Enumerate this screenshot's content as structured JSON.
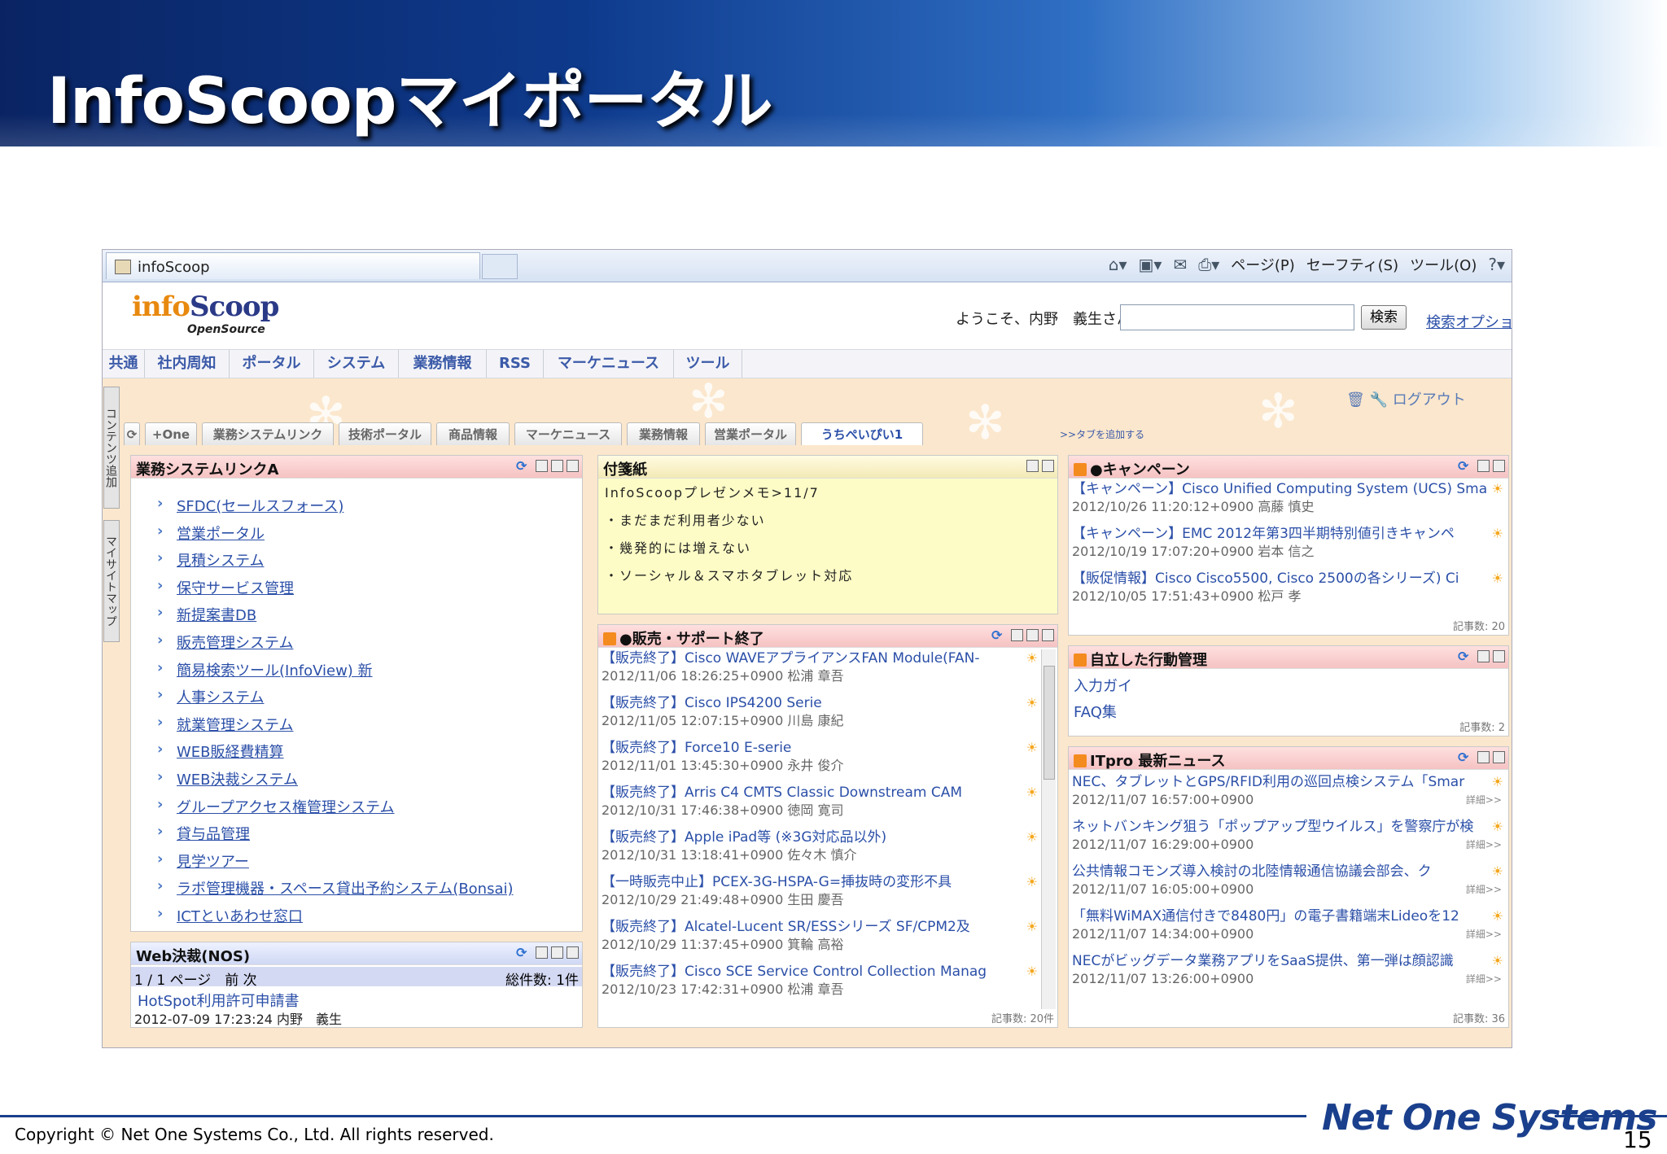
{
  "slide": {
    "title": "InfoScoopマイポータル",
    "copyright": "Copyright © Net One Systems Co., Ltd. All rights reserved.",
    "brand": "Net One Systems",
    "page_number": "15"
  },
  "browser": {
    "tab_title": "infoScoop",
    "toolbar": [
      "ページ(P)",
      "セーフティ(S)",
      "ツール(O)"
    ]
  },
  "portal": {
    "logo": "infoScoop",
    "logo_sub": "OpenSource",
    "welcome": "ようこそ、内野　義生さん",
    "search_button": "検索",
    "search_options": "検索オプショ",
    "menu": [
      "共通",
      "社内周知",
      "ポータル",
      "システム",
      "業務情報",
      "RSS",
      "マーケニュース",
      "ツール"
    ],
    "side_tabs": [
      "コンテンツ追加",
      "マイサイトマップ"
    ],
    "logout": "ログアウト",
    "tabs": [
      "+One",
      "業務システムリンク",
      "技術ポータル",
      "商品情報",
      "マーケニュース",
      "業務情報",
      "営業ポータル",
      "うちぺいぴい1"
    ],
    "add_tab": ">>タブを追加する"
  },
  "widgets": {
    "links": {
      "title": "業務システムリンクA",
      "items": [
        "SFDC(セールスフォース)",
        "営業ポータル",
        "見積システム",
        "保守サービス管理",
        "新提案書DB",
        "販売管理システム",
        "簡易検索ツール(InfoView) 新",
        "人事システム",
        "就業管理システム",
        "WEB販経費精算",
        "WEB決裁システム",
        "グループアクセス権管理システム",
        "貸与品管理",
        "見学ツアー",
        "ラボ管理機器・スペース貸出予約システム(Bonsai)",
        "ICTといあわせ窓口"
      ]
    },
    "web": {
      "title": "Web決裁(NOS)",
      "pager": "1 / 1 ページ　前 次",
      "total": "総件数: 1件",
      "item": "HotSpot利用許可申請書",
      "date": "2012-07-09 17:23:24",
      "user": "内野　義生"
    },
    "memo": {
      "title": "付箋紙",
      "lines": [
        "InfoScoopプレゼンメモ>11/7",
        "・まだまだ利用者少ない",
        "・幾発的には増えない",
        "・ソーシャル＆スマホタブレット対応"
      ]
    },
    "eol": {
      "title": "●販売・サポート終了",
      "count": "記事数: 20件",
      "items": [
        {
          "t": "【販売終了】Cisco WAVEアプライアンスFAN Module(FAN-",
          "d": "2012/11/06 18:26:25+0900",
          "u": "松浦 章吾"
        },
        {
          "t": "【販売終了】Cisco IPS4200 Serie",
          "d": "2012/11/05 12:07:15+0900",
          "u": "川島 康紀"
        },
        {
          "t": "【販売終了】Force10 E-serie",
          "d": "2012/11/01 13:45:30+0900",
          "u": "永井 俊介"
        },
        {
          "t": "【販売終了】Arris C4 CMTS Classic Downstream CAM",
          "d": "2012/10/31 17:46:38+0900",
          "u": "徳岡 寛司"
        },
        {
          "t": "【販売終了】Apple iPad等 (※3G対応品以外)",
          "d": "2012/10/31 13:18:41+0900",
          "u": "佐々木 慎介"
        },
        {
          "t": "【一時販売中止】PCEX-3G-HSPA-G=挿抜時の変形不具",
          "d": "2012/10/29 21:49:48+0900",
          "u": "生田 慶吾"
        },
        {
          "t": "【販売終了】Alcatel-Lucent SR/ESSシリーズ SF/CPM2及",
          "d": "2012/10/29 11:37:45+0900",
          "u": "箕輪 高裕"
        },
        {
          "t": "【販売終了】Cisco SCE Service Control Collection Manag",
          "d": "2012/10/23 17:42:31+0900",
          "u": "松浦 章吾"
        }
      ]
    },
    "campaign": {
      "title": "●キャンペーン",
      "count": "記事数: 20",
      "items": [
        {
          "t": "【キャンペーン】Cisco Unified Computing System (UCS) Sma",
          "d": "2012/10/26 11:20:12+0900",
          "u": "高藤 慎史"
        },
        {
          "t": "【キャンペーン】EMC 2012年第3四半期特別値引きキャンペ",
          "d": "2012/10/19 17:07:20+0900",
          "u": "岩本 信之"
        },
        {
          "t": "【販促情報】Cisco Cisco5500, Cisco 2500の各シリーズ) Ci",
          "d": "2012/10/05 17:51:43+0900",
          "u": "松戸 孝"
        }
      ]
    },
    "action": {
      "title": "自立した行動管理",
      "items": [
        "入力ガイ",
        "FAQ集"
      ],
      "count": "記事数: 2"
    },
    "itpro": {
      "title": "ITpro 最新ニュース",
      "count": "記事数: 36",
      "detail": "詳細>>",
      "items": [
        {
          "t": "NEC、タブレットとGPS/RFID利用の巡回点検システム「Smar",
          "d": "2012/11/07 16:57:00+0900"
        },
        {
          "t": "ネットバンキング狙う「ポップアップ型ウイルス」を警察庁が検",
          "d": "2012/11/07 16:29:00+0900"
        },
        {
          "t": "公共情報コモンズ導入検討の北陸情報通信協議会部会、ク",
          "d": "2012/11/07 16:05:00+0900"
        },
        {
          "t": "「無料WiMAX通信付きで8480円」の電子書籍端末Lideoを12",
          "d": "2012/11/07 14:34:00+0900"
        },
        {
          "t": "NECがビッグデータ業務アプリをSaaS提供、第一弾は顔認識",
          "d": "2012/11/07 13:26:00+0900"
        }
      ]
    }
  }
}
